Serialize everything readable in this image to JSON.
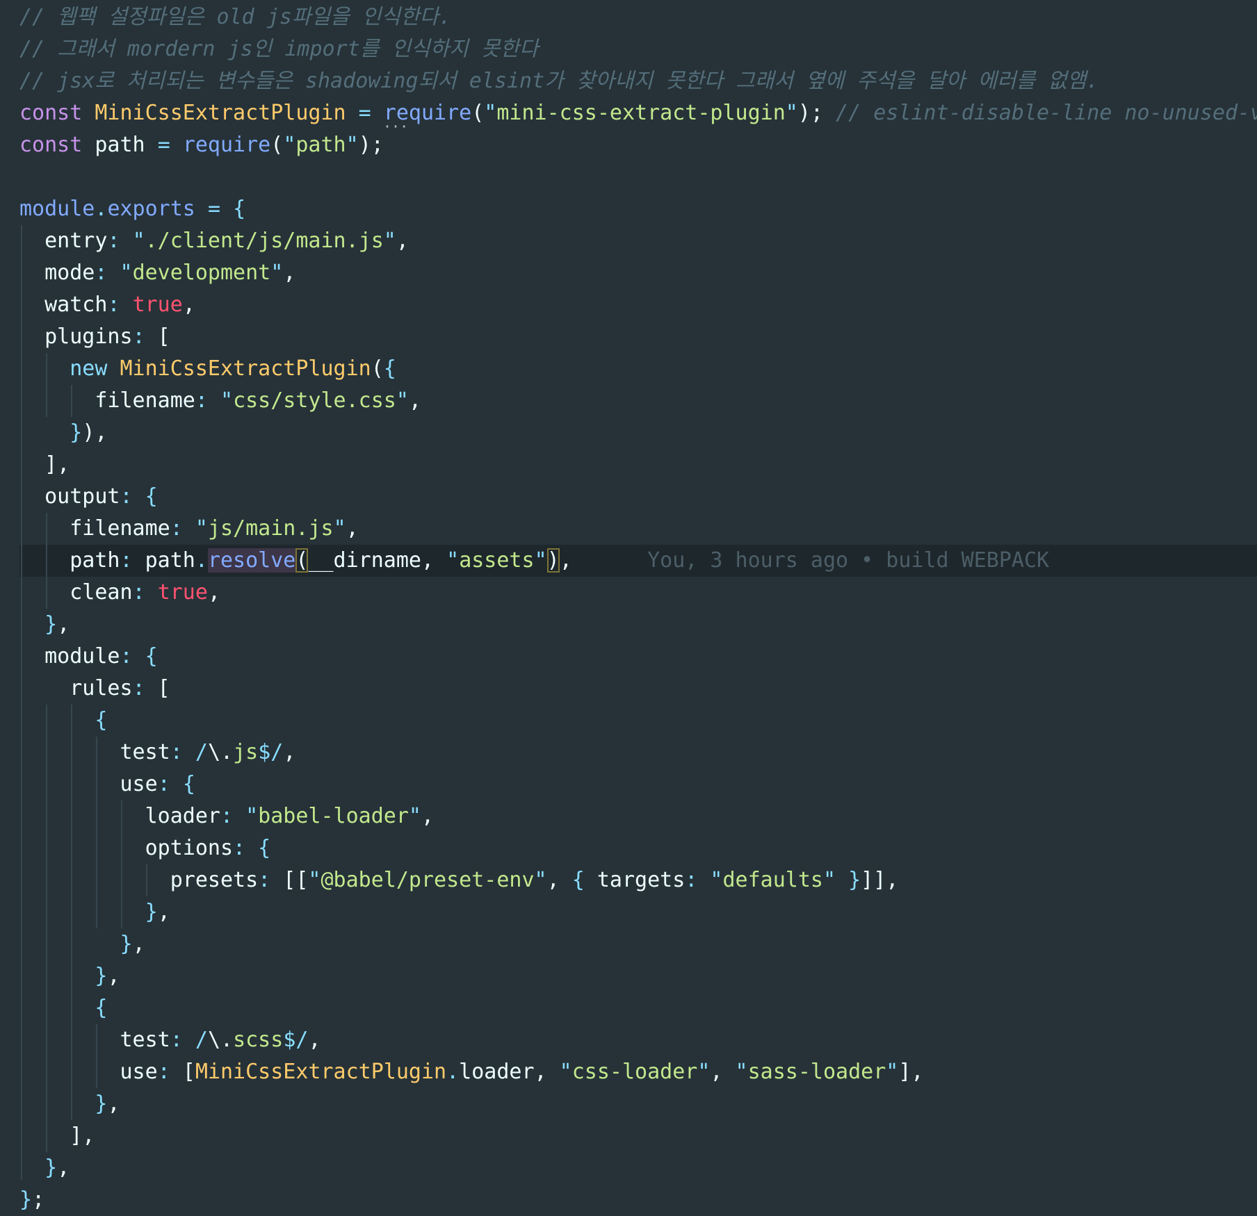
{
  "editor": {
    "language": "javascript",
    "current_line_index": 17,
    "blame": "You, 3 hours ago • build WEBPACK",
    "colors": {
      "background": "#263238",
      "comment": "#546e7a",
      "keyword": "#c792ea",
      "class_name": "#ffcb6b",
      "function": "#82aaff",
      "string": "#c3e88d",
      "punctuation": "#89ddff",
      "boolean": "#ff5370",
      "text": "#eeffff"
    },
    "lines": [
      [
        [
          "c",
          "// 웹팩 설정파일은 old js파일을 인식한다."
        ]
      ],
      [
        [
          "c",
          "// 그래서 mordern js인 import를 인식하지 못한다"
        ]
      ],
      [
        [
          "c",
          "// jsx로 처리되는 변수들은 shadowing되서 elsint가 찾아내지 못한다 그래서 옆에 주석을 달아 에러를 없앰."
        ]
      ],
      [
        [
          "k",
          "const "
        ],
        [
          "n",
          "MiniCssExtractPlugin"
        ],
        [
          "t",
          " "
        ],
        [
          "p",
          "="
        ],
        [
          "t",
          " "
        ],
        [
          "f",
          "require"
        ],
        [
          "t",
          "("
        ],
        [
          "p",
          "\""
        ],
        [
          "s",
          "mini-css-extract-plugin"
        ],
        [
          "p",
          "\""
        ],
        [
          "t",
          ");"
        ],
        [
          "t",
          " "
        ],
        [
          "c",
          "// eslint-disable-line no-unused-vars"
        ]
      ],
      [
        [
          "k",
          "const "
        ],
        [
          "t",
          "path "
        ],
        [
          "p",
          "="
        ],
        [
          "t",
          " "
        ],
        [
          "f",
          "require"
        ],
        [
          "t",
          "("
        ],
        [
          "p",
          "\""
        ],
        [
          "s",
          "path"
        ],
        [
          "p",
          "\""
        ],
        [
          "t",
          ");"
        ]
      ],
      [],
      [
        [
          "f",
          "module"
        ],
        [
          "p",
          "."
        ],
        [
          "f",
          "exports"
        ],
        [
          "t",
          " "
        ],
        [
          "p",
          "="
        ],
        [
          "t",
          " "
        ],
        [
          "p",
          "{"
        ]
      ],
      [
        [
          "t",
          "  entry"
        ],
        [
          "p",
          ":"
        ],
        [
          "t",
          " "
        ],
        [
          "p",
          "\""
        ],
        [
          "s",
          "./client/js/main.js"
        ],
        [
          "p",
          "\""
        ],
        [
          "t",
          ","
        ]
      ],
      [
        [
          "t",
          "  mode"
        ],
        [
          "p",
          ":"
        ],
        [
          "t",
          " "
        ],
        [
          "p",
          "\""
        ],
        [
          "s",
          "development"
        ],
        [
          "p",
          "\""
        ],
        [
          "t",
          ","
        ]
      ],
      [
        [
          "t",
          "  watch"
        ],
        [
          "p",
          ":"
        ],
        [
          "t",
          " "
        ],
        [
          "b",
          "true"
        ],
        [
          "t",
          ","
        ]
      ],
      [
        [
          "t",
          "  plugins"
        ],
        [
          "p",
          ":"
        ],
        [
          "t",
          " ["
        ]
      ],
      [
        [
          "t",
          "    "
        ],
        [
          "p",
          "new "
        ],
        [
          "n",
          "MiniCssExtractPlugin"
        ],
        [
          "t",
          "("
        ],
        [
          "p",
          "{"
        ]
      ],
      [
        [
          "t",
          "      filename"
        ],
        [
          "p",
          ":"
        ],
        [
          "t",
          " "
        ],
        [
          "p",
          "\""
        ],
        [
          "s",
          "css/style.css"
        ],
        [
          "p",
          "\""
        ],
        [
          "t",
          ","
        ]
      ],
      [
        [
          "t",
          "    "
        ],
        [
          "p",
          "}"
        ],
        [
          "t",
          "),"
        ]
      ],
      [
        [
          "t",
          "  ],"
        ]
      ],
      [
        [
          "t",
          "  output"
        ],
        [
          "p",
          ":"
        ],
        [
          "t",
          " "
        ],
        [
          "p",
          "{"
        ]
      ],
      [
        [
          "t",
          "    filename"
        ],
        [
          "p",
          ":"
        ],
        [
          "t",
          " "
        ],
        [
          "p",
          "\""
        ],
        [
          "s",
          "js/main.js"
        ],
        [
          "p",
          "\""
        ],
        [
          "t",
          ","
        ]
      ],
      [
        [
          "t",
          "    path"
        ],
        [
          "p",
          ":"
        ],
        [
          "t",
          " path"
        ],
        [
          "p",
          "."
        ],
        [
          "fh",
          "resolve"
        ],
        [
          "tb",
          "("
        ],
        [
          "t",
          "__dirname, "
        ],
        [
          "p",
          "\""
        ],
        [
          "s",
          "assets"
        ],
        [
          "p",
          "\""
        ],
        [
          "tb",
          ")"
        ],
        [
          "t",
          ","
        ],
        [
          "t",
          "      "
        ],
        [
          "bl",
          "You, 3 hours ago • build WEBPACK"
        ]
      ],
      [
        [
          "t",
          "    clean"
        ],
        [
          "p",
          ":"
        ],
        [
          "t",
          " "
        ],
        [
          "b",
          "true"
        ],
        [
          "t",
          ","
        ]
      ],
      [
        [
          "t",
          "  "
        ],
        [
          "p",
          "}"
        ],
        [
          "t",
          ","
        ]
      ],
      [
        [
          "t",
          "  module"
        ],
        [
          "p",
          ":"
        ],
        [
          "t",
          " "
        ],
        [
          "p",
          "{"
        ]
      ],
      [
        [
          "t",
          "    rules"
        ],
        [
          "p",
          ":"
        ],
        [
          "t",
          " ["
        ]
      ],
      [
        [
          "t",
          "      "
        ],
        [
          "p",
          "{"
        ]
      ],
      [
        [
          "t",
          "        test"
        ],
        [
          "p",
          ":"
        ],
        [
          "t",
          " "
        ],
        [
          "p",
          "/"
        ],
        [
          "t",
          "\\."
        ],
        [
          "s",
          "js"
        ],
        [
          "p",
          "$/"
        ],
        [
          "t",
          ","
        ]
      ],
      [
        [
          "t",
          "        use"
        ],
        [
          "p",
          ":"
        ],
        [
          "t",
          " "
        ],
        [
          "p",
          "{"
        ]
      ],
      [
        [
          "t",
          "          loader"
        ],
        [
          "p",
          ":"
        ],
        [
          "t",
          " "
        ],
        [
          "p",
          "\""
        ],
        [
          "s",
          "babel-loader"
        ],
        [
          "p",
          "\""
        ],
        [
          "t",
          ","
        ]
      ],
      [
        [
          "t",
          "          options"
        ],
        [
          "p",
          ":"
        ],
        [
          "t",
          " "
        ],
        [
          "p",
          "{"
        ]
      ],
      [
        [
          "t",
          "            presets"
        ],
        [
          "p",
          ":"
        ],
        [
          "t",
          " [["
        ],
        [
          "p",
          "\""
        ],
        [
          "s",
          "@babel/preset-env"
        ],
        [
          "p",
          "\""
        ],
        [
          "t",
          ", "
        ],
        [
          "p",
          "{"
        ],
        [
          "t",
          " targets"
        ],
        [
          "p",
          ":"
        ],
        [
          "t",
          " "
        ],
        [
          "p",
          "\""
        ],
        [
          "s",
          "defaults"
        ],
        [
          "p",
          "\""
        ],
        [
          "t",
          " "
        ],
        [
          "p",
          "}"
        ],
        [
          "t",
          "]],"
        ]
      ],
      [
        [
          "t",
          "          "
        ],
        [
          "p",
          "}"
        ],
        [
          "t",
          ","
        ]
      ],
      [
        [
          "t",
          "        "
        ],
        [
          "p",
          "}"
        ],
        [
          "t",
          ","
        ]
      ],
      [
        [
          "t",
          "      "
        ],
        [
          "p",
          "}"
        ],
        [
          "t",
          ","
        ]
      ],
      [
        [
          "t",
          "      "
        ],
        [
          "p",
          "{"
        ]
      ],
      [
        [
          "t",
          "        test"
        ],
        [
          "p",
          ":"
        ],
        [
          "t",
          " "
        ],
        [
          "p",
          "/"
        ],
        [
          "t",
          "\\."
        ],
        [
          "s",
          "scss"
        ],
        [
          "p",
          "$/"
        ],
        [
          "t",
          ","
        ]
      ],
      [
        [
          "t",
          "        use"
        ],
        [
          "p",
          ":"
        ],
        [
          "t",
          " ["
        ],
        [
          "n",
          "MiniCssExtractPlugin"
        ],
        [
          "p",
          "."
        ],
        [
          "t",
          "loader, "
        ],
        [
          "p",
          "\""
        ],
        [
          "s",
          "css-loader"
        ],
        [
          "p",
          "\""
        ],
        [
          "t",
          ", "
        ],
        [
          "p",
          "\""
        ],
        [
          "s",
          "sass-loader"
        ],
        [
          "p",
          "\""
        ],
        [
          "t",
          "],"
        ]
      ],
      [
        [
          "t",
          "      "
        ],
        [
          "p",
          "}"
        ],
        [
          "t",
          ","
        ]
      ],
      [
        [
          "t",
          "    ],"
        ]
      ],
      [
        [
          "t",
          "  "
        ],
        [
          "p",
          "}"
        ],
        [
          "t",
          ","
        ]
      ],
      [
        [
          "p",
          "}"
        ],
        [
          "t",
          ";"
        ]
      ]
    ]
  }
}
